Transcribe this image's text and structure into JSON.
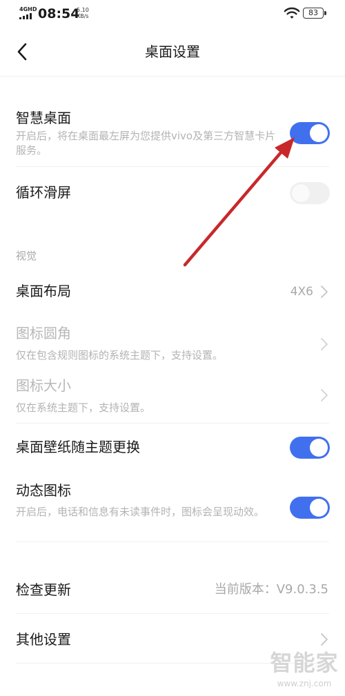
{
  "status_bar": {
    "network": "4GHD",
    "time": "08:54",
    "speed_value": "5.10",
    "speed_unit": "KB/s",
    "battery": "83"
  },
  "header": {
    "title": "桌面设置"
  },
  "settings": {
    "smart_desktop": {
      "title": "智慧桌面",
      "desc": "开启后，将在桌面最左屏为您提供vivo及第三方智慧卡片服务。",
      "enabled": true
    },
    "loop_scroll": {
      "title": "循环滑屏",
      "enabled": false
    },
    "section_visual": "视觉",
    "desktop_layout": {
      "title": "桌面布局",
      "value": "4X6"
    },
    "icon_corner": {
      "title": "图标圆角",
      "desc": "仅在包含规则图标的系统主题下，支持设置。"
    },
    "icon_size": {
      "title": "图标大小",
      "desc": "仅在系统主题下，支持设置。"
    },
    "wallpaper_theme": {
      "title": "桌面壁纸随主题更换",
      "enabled": true
    },
    "dynamic_icon": {
      "title": "动态图标",
      "desc": "开启后，电话和信息有未读事件时，图标会呈现动效。",
      "enabled": true
    },
    "check_update": {
      "title": "检查更新",
      "value": "当前版本：V9.0.3.5"
    },
    "other_settings": {
      "title": "其他设置"
    }
  },
  "watermark": {
    "text": "智能家",
    "url": "www.znj.com"
  },
  "colors": {
    "toggle_on": "#4170ef",
    "toggle_off": "#f0f0f0",
    "annotation_arrow": "#c8282a"
  }
}
